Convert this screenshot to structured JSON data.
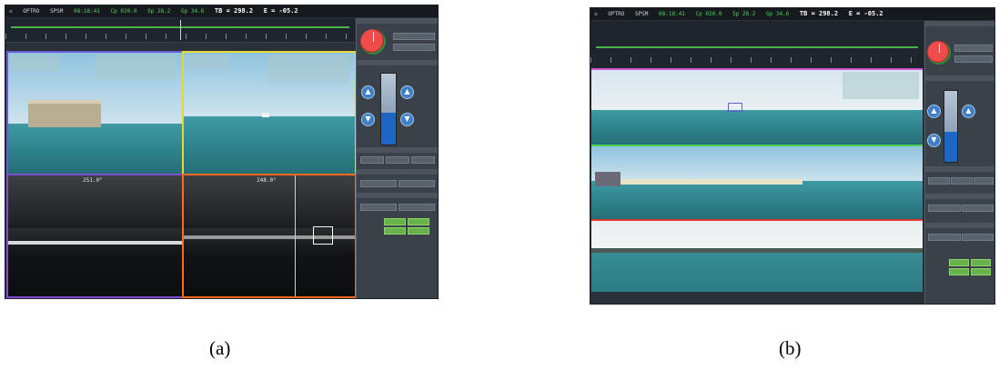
{
  "figure": {
    "captions": {
      "a": "(a)",
      "b": "(b)"
    }
  },
  "screenshot_a": {
    "topbar": {
      "app": "OPTRO",
      "sep": "SPSM",
      "time": "08:18:41",
      "cap": "Cp 020.0",
      "sp": "Sp 28.2",
      "gp": "Gp 34.6",
      "tb": "TB = 298.2",
      "e": "E = -05.2"
    },
    "quad_labels": {
      "ir_left": "251.0°",
      "ir_right": "248.0°"
    }
  },
  "screenshot_b": {
    "topbar": {
      "app": "OPTRO",
      "sep": "SPSM",
      "time": "08:18:41",
      "cap": "Cp 020.0",
      "sp": "Sp 28.2",
      "gp": "Gp 34.6",
      "tb": "TB = 298.2",
      "e": "E = -05.2"
    }
  },
  "colors": {
    "frame_blue": "#6a5ad6",
    "frame_yellow": "#e5d834",
    "frame_purple": "#7d4fd0",
    "frame_orange": "#ff6a1c",
    "band_green": "#4fd25a",
    "band_magenta": "#d452d4",
    "band_red": "#e23a2a"
  },
  "icons": [
    "compass-icon",
    "chevron-up-icon",
    "chevron-down-icon"
  ]
}
